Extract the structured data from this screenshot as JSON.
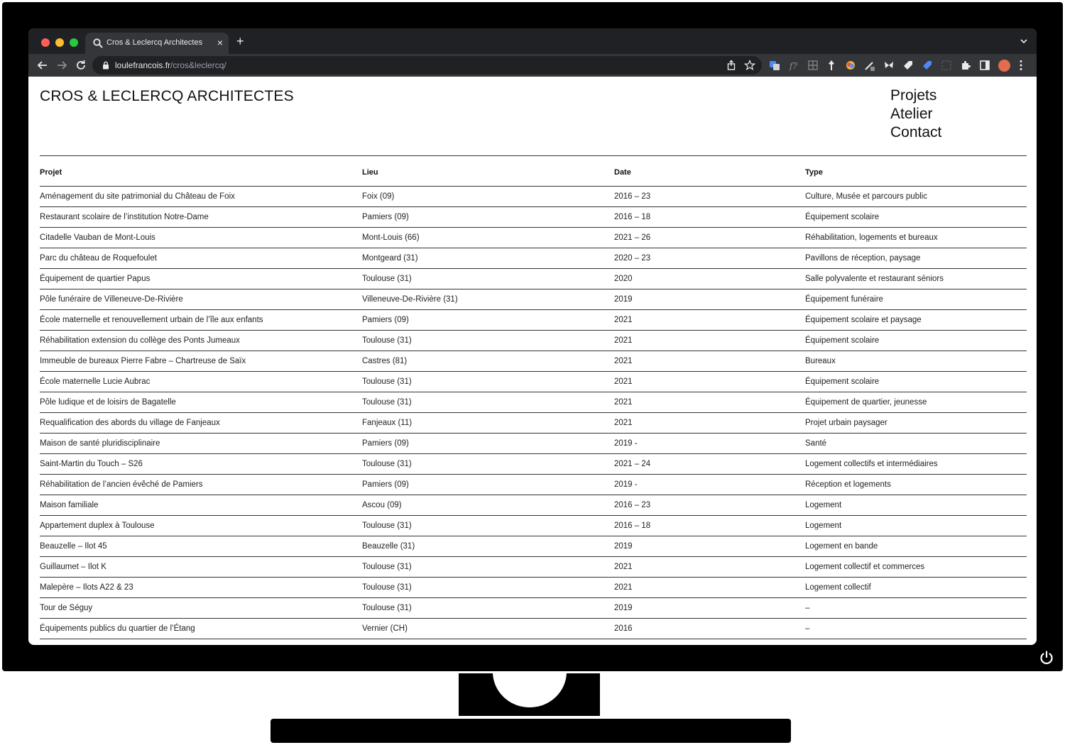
{
  "browser": {
    "tab_title": "Cros & Leclercq Architectes",
    "tab_close": "×",
    "new_tab": "+",
    "url_host": "loulefrancois.fr",
    "url_path": "/cros&leclercq/"
  },
  "site": {
    "title": "CROS & LECLERCQ ARCHITECTES",
    "nav": [
      "Projets",
      "Atelier",
      "Contact"
    ]
  },
  "table": {
    "headers": [
      "Projet",
      "Lieu",
      "Date",
      "Type"
    ],
    "rows": [
      [
        "Aménagement du site patrimonial du Château de Foix",
        "Foix (09)",
        "2016 – 23",
        "Culture, Musée et parcours public"
      ],
      [
        "Restaurant scolaire de l’institution Notre-Dame",
        "Pamiers (09)",
        "2016 – 18",
        "Équipement scolaire"
      ],
      [
        "Citadelle Vauban de Mont-Louis",
        "Mont-Louis (66)",
        "2021 – 26",
        "Réhabilitation, logements et bureaux"
      ],
      [
        "Parc du château de Roquefoulet",
        "Montgeard (31)",
        "2020 – 23",
        "Pavillons de réception, paysage"
      ],
      [
        "Équipement de quartier Papus",
        "Toulouse (31)",
        "2020",
        "Salle polyvalente et restaurant séniors"
      ],
      [
        "Pôle funéraire de Villeneuve-De-Rivière",
        "Villeneuve-De-Rivière (31)",
        "2019",
        "Équipement funéraire"
      ],
      [
        "École maternelle et renouvellement urbain de l’île aux enfants",
        "Pamiers (09)",
        "2021",
        "Équipement scolaire et paysage"
      ],
      [
        "Réhabilitation extension du collège des Ponts Jumeaux",
        "Toulouse (31)",
        "2021",
        "Équipement scolaire"
      ],
      [
        "Immeuble de bureaux Pierre Fabre – Chartreuse de Saïx",
        "Castres (81)",
        "2021",
        "Bureaux"
      ],
      [
        "École maternelle Lucie Aubrac",
        "Toulouse (31)",
        "2021",
        "Équipement scolaire"
      ],
      [
        "Pôle ludique et de loisirs de Bagatelle",
        "Toulouse (31)",
        "2021",
        "Équipement de quartier, jeunesse"
      ],
      [
        "Requalification des abords du village de Fanjeaux",
        "Fanjeaux (11)",
        "2021",
        "Projet urbain paysager"
      ],
      [
        "Maison de santé pluridisciplinaire",
        "Pamiers (09)",
        "2019 -",
        "Santé"
      ],
      [
        "Saint-Martin du Touch – S26",
        "Toulouse (31)",
        "2021 – 24",
        "Logement collectifs et intermédiaires"
      ],
      [
        "Réhabilitation de l’ancien évêché de Pamiers",
        "Pamiers (09)",
        "2019 -",
        "Réception et logements"
      ],
      [
        "Maison familiale",
        "Ascou (09)",
        "2016 – 23",
        "Logement"
      ],
      [
        "Appartement duplex à Toulouse",
        "Toulouse (31)",
        "2016 – 18",
        "Logement"
      ],
      [
        "Beauzelle – Ilot 45",
        "Beauzelle (31)",
        "2019",
        "Logement en bande"
      ],
      [
        "Guillaumet – Ilot K",
        "Toulouse (31)",
        "2021",
        "Logement collectif et commerces"
      ],
      [
        "Malepère – Ilots A22 & 23",
        "Toulouse (31)",
        "2021",
        "Logement collectif"
      ],
      [
        "Tour de Séguy",
        "Toulouse (31)",
        "2019",
        "–"
      ],
      [
        "Équipements publics du quartier de l’Étang",
        "Vernier (CH)",
        "2016",
        "–"
      ]
    ]
  },
  "colors": {
    "bezel": "#000000",
    "tabbar": "#202124",
    "toolbar": "#35363a",
    "rule": "#333333",
    "text": "#111111"
  }
}
